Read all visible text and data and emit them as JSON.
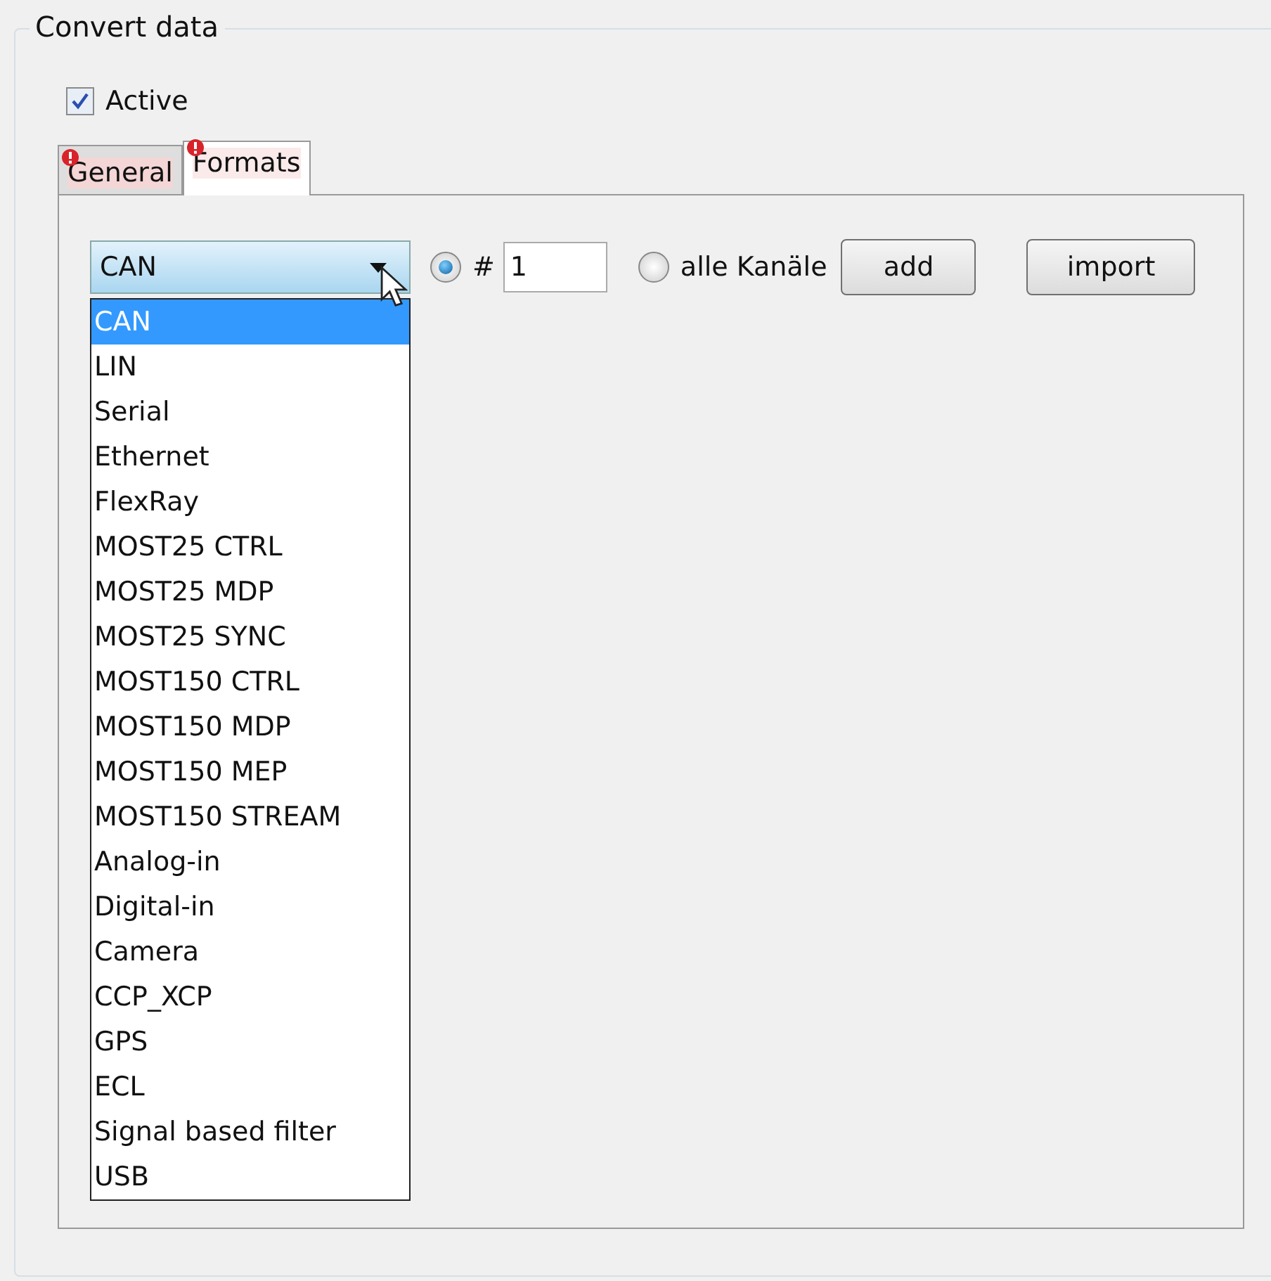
{
  "group": {
    "title": "Convert data"
  },
  "active": {
    "label": "Active",
    "checked": true
  },
  "tabs": [
    {
      "label": "General",
      "selected": false,
      "warning": true
    },
    {
      "label": "Formats",
      "selected": true,
      "warning": true
    }
  ],
  "format_dropdown": {
    "value": "CAN",
    "expanded": true,
    "options": [
      {
        "label": "CAN",
        "selected": true
      },
      {
        "label": "LIN",
        "selected": false
      },
      {
        "label": "Serial",
        "selected": false
      },
      {
        "label": "Ethernet",
        "selected": false
      },
      {
        "label": "FlexRay",
        "selected": false
      },
      {
        "label": "MOST25 CTRL",
        "selected": false
      },
      {
        "label": "MOST25 MDP",
        "selected": false
      },
      {
        "label": "MOST25 SYNC",
        "selected": false
      },
      {
        "label": "MOST150 CTRL",
        "selected": false
      },
      {
        "label": "MOST150 MDP",
        "selected": false
      },
      {
        "label": "MOST150 MEP",
        "selected": false
      },
      {
        "label": "MOST150 STREAM",
        "selected": false
      },
      {
        "label": "Analog-in",
        "selected": false
      },
      {
        "label": "Digital-in",
        "selected": false
      },
      {
        "label": "Camera",
        "selected": false
      },
      {
        "label": "CCP_XCP",
        "selected": false
      },
      {
        "label": "GPS",
        "selected": false
      },
      {
        "label": "ECL",
        "selected": false
      },
      {
        "label": "Signal based filter",
        "selected": false
      },
      {
        "label": "USB",
        "selected": false
      }
    ]
  },
  "channel_radios": [
    {
      "kind": "number",
      "label": "#",
      "value": "1",
      "selected": true
    },
    {
      "kind": "all",
      "label": "alle Kanäle",
      "selected": false
    }
  ],
  "buttons": [
    "add",
    "import"
  ]
}
